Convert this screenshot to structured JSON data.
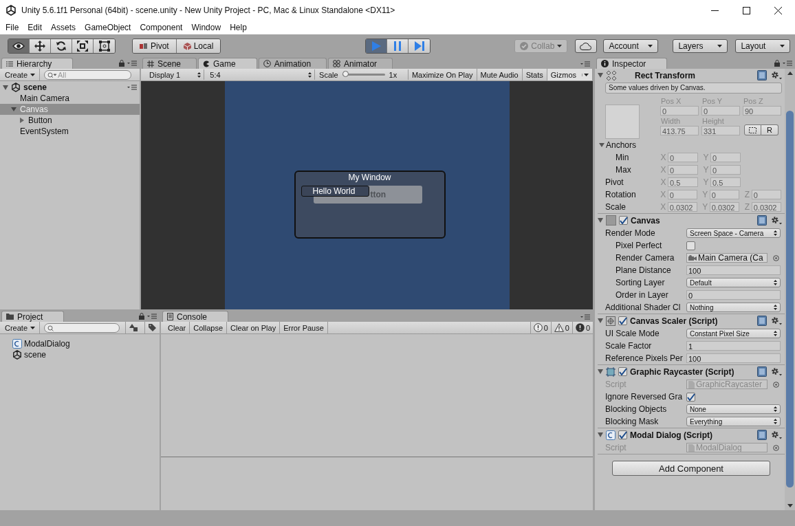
{
  "window": {
    "title": "Unity 5.6.1f1 Personal (64bit) - scene.unity - New Unity Project - PC, Mac & Linux Standalone <DX11>"
  },
  "menu": [
    "File",
    "Edit",
    "Assets",
    "GameObject",
    "Component",
    "Window",
    "Help"
  ],
  "toolbar": {
    "tools": [
      {
        "kind": "view",
        "selected": true
      },
      {
        "kind": "move",
        "selected": false
      },
      {
        "kind": "rotate",
        "selected": false
      },
      {
        "kind": "scale",
        "selected": false
      },
      {
        "kind": "rect",
        "selected": false
      }
    ],
    "handles": [
      {
        "kind": "pivot",
        "label": "Pivot"
      },
      {
        "kind": "local",
        "label": "Local"
      }
    ],
    "playback": [
      {
        "kind": "play",
        "selected": true
      },
      {
        "kind": "pause",
        "selected": false
      },
      {
        "kind": "step",
        "selected": false
      }
    ],
    "collab": {
      "label": "Collab",
      "disabled": true
    },
    "menus": [
      "Account",
      "Layers",
      "Layout"
    ]
  },
  "hierarchy": {
    "title": "Hierarchy",
    "create": "Create",
    "search_placeholder": "All",
    "scene": "scene",
    "items": [
      {
        "kind": "leaf",
        "label": "Main Camera",
        "selected": false
      },
      {
        "kind": "group",
        "label": "Canvas",
        "selected": true,
        "expanded": true,
        "children": [
          {
            "kind": "group",
            "label": "Button",
            "selected": false,
            "expanded": false
          }
        ]
      },
      {
        "kind": "leaf",
        "label": "EventSystem",
        "selected": false
      }
    ]
  },
  "game_panel": {
    "tabs": [
      {
        "kind": "scene",
        "label": "Scene",
        "selected": false
      },
      {
        "kind": "game",
        "label": "Game",
        "selected": true
      },
      {
        "kind": "animation",
        "label": "Animation",
        "selected": false
      },
      {
        "kind": "animator",
        "label": "Animator",
        "selected": false
      }
    ],
    "display": "Display 1",
    "aspect": "5:4",
    "scale": {
      "label": "Scale",
      "level": 0,
      "reading": "1x"
    },
    "toggles": [
      "Maximize On Play",
      "Mute Audio",
      "Stats"
    ],
    "gizmos": "Gizmos",
    "dialog": {
      "title": "My Window",
      "button": "tton",
      "tooltip": "Hello World"
    }
  },
  "project": {
    "title": "Project",
    "create": "Create",
    "items": [
      {
        "kind": "script",
        "label": "ModalDialog"
      },
      {
        "kind": "scene",
        "label": "scene"
      }
    ]
  },
  "console": {
    "title": "Console",
    "buttons": [
      "Clear",
      "Collapse",
      "Clear on Play",
      "Error Pause"
    ],
    "counters": [
      {
        "kind": "info",
        "count": "0"
      },
      {
        "kind": "warning",
        "count": "0"
      },
      {
        "kind": "error",
        "count": "0"
      }
    ]
  },
  "inspector": {
    "title": "Inspector",
    "rect_transform": {
      "title": "Rect Transform",
      "note": "Some values driven by Canvas.",
      "position": [
        {
          "label": "Pos X",
          "value": "0"
        },
        {
          "label": "Pos Y",
          "value": "0"
        },
        {
          "label": "Pos Z",
          "value": "90"
        }
      ],
      "size": [
        {
          "label": "Width",
          "value": "413.75"
        },
        {
          "label": "Height",
          "value": "331"
        }
      ],
      "reset": "R",
      "anchors": {
        "label": "Anchors",
        "expanded": true,
        "rows": [
          {
            "label": "Min",
            "fields": [
              {
                "axis": "X",
                "value": "0"
              },
              {
                "axis": "Y",
                "value": "0"
              }
            ]
          },
          {
            "label": "Max",
            "fields": [
              {
                "axis": "X",
                "value": "0"
              },
              {
                "axis": "Y",
                "value": "0"
              }
            ]
          }
        ]
      },
      "rows": [
        {
          "label": "Pivot",
          "fields": [
            {
              "axis": "X",
              "value": "0.5"
            },
            {
              "axis": "Y",
              "value": "0.5"
            }
          ]
        },
        {
          "label": "Rotation",
          "fields": [
            {
              "axis": "X",
              "value": "0"
            },
            {
              "axis": "Y",
              "value": "0"
            },
            {
              "axis": "Z",
              "value": "0"
            }
          ]
        },
        {
          "label": "Scale",
          "fields": [
            {
              "axis": "X",
              "value": "0.0302"
            },
            {
              "axis": "Y",
              "value": "0.0302"
            },
            {
              "axis": "Z",
              "value": "0.0302"
            }
          ]
        }
      ]
    },
    "components": [
      {
        "kind": "canvas",
        "title": "Canvas",
        "enabled": true,
        "rows": [
          {
            "kind": "dropdown",
            "label": "Render Mode",
            "value": "Screen Space - Camera",
            "children": [
              {
                "kind": "checkbox",
                "label": "Pixel Perfect",
                "checked": false
              },
              {
                "kind": "object",
                "label": "Render Camera",
                "value": "Main Camera (Ca"
              },
              {
                "kind": "text",
                "label": "Plane Distance",
                "value": "100"
              },
              {
                "kind": "dropdown",
                "label": "Sorting Layer",
                "value": "Default"
              },
              {
                "kind": "text",
                "label": "Order in Layer",
                "value": "0"
              }
            ]
          },
          {
            "kind": "dropdown",
            "label": "Additional Shader Cl",
            "value": "Nothing"
          }
        ]
      },
      {
        "kind": "scaler",
        "title": "Canvas Scaler (Script)",
        "enabled": true,
        "rows": [
          {
            "kind": "dropdown",
            "label": "UI Scale Mode",
            "value": "Constant Pixel Size"
          },
          {
            "kind": "text",
            "label": "Scale Factor",
            "value": "1"
          },
          {
            "kind": "text",
            "label": "Reference Pixels Per",
            "value": "100"
          }
        ]
      },
      {
        "kind": "raycaster",
        "title": "Graphic Raycaster (Script)",
        "enabled": true,
        "rows": [
          {
            "kind": "script",
            "label": "Script",
            "value": "GraphicRaycaster"
          },
          {
            "kind": "checkbox",
            "label": "Ignore Reversed Gra",
            "checked": true
          },
          {
            "kind": "dropdown",
            "label": "Blocking Objects",
            "value": "None"
          },
          {
            "kind": "dropdown",
            "label": "Blocking Mask",
            "value": "Everything"
          }
        ]
      },
      {
        "kind": "script",
        "title": "Modal Dialog (Script)",
        "enabled": true,
        "rows": [
          {
            "kind": "script",
            "label": "Script",
            "value": "ModalDialog"
          }
        ]
      }
    ],
    "add_button": "Add Component"
  }
}
